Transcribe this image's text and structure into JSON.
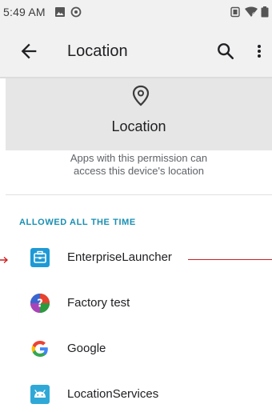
{
  "status_bar": {
    "time": "5:49 AM",
    "icons": [
      "image-icon",
      "sync-icon",
      "vibrate-icon",
      "wifi-icon",
      "battery-icon"
    ]
  },
  "toolbar": {
    "back_icon": "arrow-back-icon",
    "title": "Location",
    "search_icon": "search-icon",
    "more_icon": "more-vert-icon"
  },
  "header": {
    "icon": "location-pin-icon",
    "title": "Location",
    "description_line1": "Apps with this permission can",
    "description_line2": "access this device's location"
  },
  "section": {
    "label": "ALLOWED ALL THE TIME"
  },
  "apps": [
    {
      "name": "EnterpriseLauncher",
      "icon": "enterprise-launcher-icon"
    },
    {
      "name": "Factory test",
      "icon": "factory-test-icon"
    },
    {
      "name": "Google",
      "icon": "google-icon"
    },
    {
      "name": "LocationServices",
      "icon": "android-location-icon"
    }
  ],
  "colors": {
    "bar_background": "#f1f1f1",
    "header_band": "#e6e6e6",
    "section_accent": "#1a8fb3",
    "annotation": "#cc1f1f"
  }
}
